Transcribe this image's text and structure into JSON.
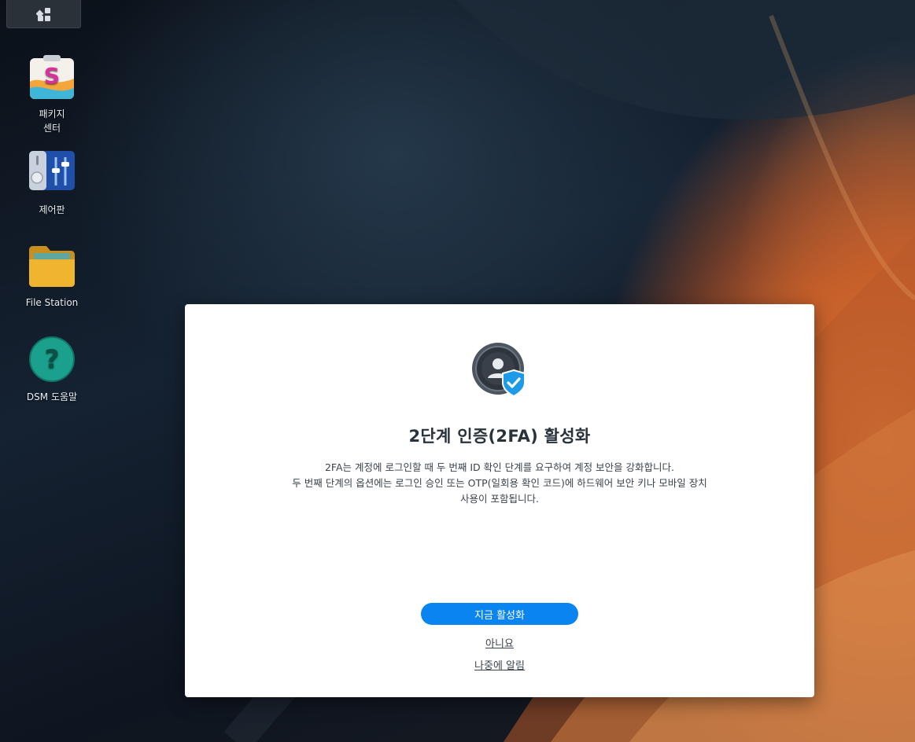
{
  "taskbar": {
    "main_menu_icon": "grid-icon"
  },
  "desktop_icons": [
    {
      "label": "패키지\n센터",
      "icon": "package-center-icon"
    },
    {
      "label": "제어판",
      "icon": "control-panel-icon"
    },
    {
      "label": "File Station",
      "icon": "folder-icon"
    },
    {
      "label": "DSM 도움말",
      "icon": "help-icon"
    }
  ],
  "dialog": {
    "icon": "shield-user-icon",
    "title": "2단계 인증(2FA) 활성화",
    "description_lines": [
      "2FA는 계정에 로그인할 때 두 번째 ID 확인 단계를 요구하여 계정 보안을 강화합니다.",
      "두 번째 단계의 옵션에는 로그인 승인 또는 OTP(일회용 확인 코드)에 하드웨어 보안 키나 모바일 장치",
      "사용이 포함됩니다."
    ],
    "enable_button": "지금 활성화",
    "no_link": "아니요",
    "later_link": "나중에 알림"
  },
  "colors": {
    "accent": "#0a84f0",
    "dialog_bg": "#ffffff",
    "title_text": "#2a333c"
  }
}
